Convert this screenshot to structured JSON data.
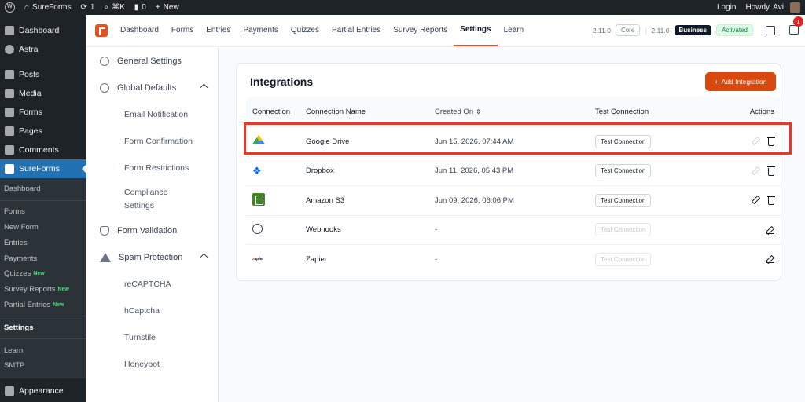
{
  "adminbar": {
    "site_name": "SureForms",
    "updates_count": "1",
    "shortcut": "⌘K",
    "comments_count": "0",
    "new_label": "New",
    "login_label": "Login",
    "howdy_label": "Howdy, Avi"
  },
  "wpmenu": {
    "top_items": [
      {
        "label": "Dashboard",
        "icon": "dashboard-icon"
      },
      {
        "label": "Astra",
        "icon": "astra-icon"
      }
    ],
    "items": [
      {
        "label": "Posts",
        "icon": "pin-icon"
      },
      {
        "label": "Media",
        "icon": "media-icon"
      },
      {
        "label": "Forms",
        "icon": "forms-icon"
      },
      {
        "label": "Pages",
        "icon": "pages-icon"
      },
      {
        "label": "Comments",
        "icon": "comments-icon"
      }
    ],
    "active_label": "SureForms",
    "submenu": {
      "dashboard": "Dashboard",
      "forms": "Forms",
      "new_form": "New Form",
      "entries": "Entries",
      "payments": "Payments",
      "quizzes": "Quizzes",
      "survey_reports": "Survey Reports",
      "partial_entries": "Partial Entries",
      "settings": "Settings",
      "learn": "Learn",
      "smtp": "SMTP",
      "new_badge": "New"
    },
    "appearance_label": "Appearance"
  },
  "sfnav": {
    "links": [
      "Dashboard",
      "Forms",
      "Entries",
      "Payments",
      "Quizzes",
      "Partial Entries",
      "Survey Reports",
      "Settings",
      "Learn"
    ],
    "active_index": 7,
    "core_version": "2.11.0",
    "core_label": "Core",
    "business_version": "2.11.0",
    "business_label": "Business",
    "activated_label": "Activated",
    "notification_count": "1"
  },
  "settings_sidebar": {
    "general": "General Settings",
    "global_defaults": "Global Defaults",
    "email_notification": "Email Notification",
    "form_confirmation": "Form Confirmation",
    "form_restrictions": "Form Restrictions",
    "compliance_settings": "Compliance Settings",
    "form_validation": "Form Validation",
    "spam_protection": "Spam Protection",
    "recaptcha": "reCAPTCHA",
    "hcaptcha": "hCaptcha",
    "turnstile": "Turnstile",
    "honeypot": "Honeypot"
  },
  "integrations": {
    "title": "Integrations",
    "add_button": "Add Integration",
    "headers": {
      "connection": "Connection",
      "name": "Connection Name",
      "created": "Created On",
      "test": "Test Connection",
      "actions": "Actions"
    },
    "test_label": "Test Connection",
    "rows": [
      {
        "name": "Google Drive",
        "created": "Jun 15, 2026, 07:44 AM",
        "icon": "google-drive-icon"
      },
      {
        "name": "Dropbox",
        "created": "Jun 11, 2026, 05:43 PM",
        "icon": "dropbox-icon"
      },
      {
        "name": "Amazon S3",
        "created": "Jun 09, 2026, 06:06 PM",
        "icon": "amazon-s3-icon"
      },
      {
        "name": "Webhooks",
        "created": "-",
        "icon": "webhook-icon"
      },
      {
        "name": "Zapier",
        "created": "-",
        "icon": "zapier-icon",
        "logo_text": "zapier"
      }
    ]
  },
  "colors": {
    "accent": "#d9480f",
    "wp_active": "#2271b1",
    "highlight": "#e23a2a"
  }
}
